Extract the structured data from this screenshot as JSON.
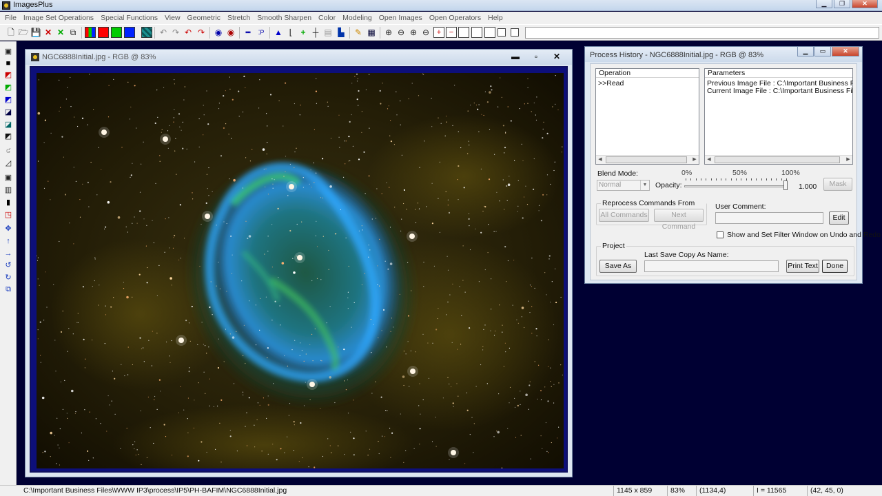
{
  "app": {
    "title": "ImagesPlus"
  },
  "menu": [
    "File",
    "Image Set Operations",
    "Special Functions",
    "View",
    "Geometric",
    "Stretch",
    "Smooth Sharpen",
    "Color",
    "Modeling",
    "Open Images",
    "Open Operators",
    "Help"
  ],
  "toolbar": {
    "icons": [
      "new-file-icon",
      "open-folder-icon",
      "save-icon",
      "close-x-icon",
      "close-all-icon",
      "copy-icon",
      "rgb-channels-icon",
      "red-channel-icon",
      "green-channel-icon",
      "blue-channel-icon",
      "mono-channel-icon",
      "undo-icon",
      "redo-icon",
      "undo-all-icon",
      "redo-all-icon",
      "circle-select-icon",
      "circle-select-alt-icon",
      "dotted-line-icon",
      "point-select-icon",
      "histogram-icon",
      "curve-icon",
      "crosshair-icon",
      "grid-crosshair-icon",
      "table-icon",
      "image-edit-icon",
      "pencil-icon",
      "grid-icon",
      "zoom-in-icon",
      "zoom-out-icon",
      "zoom-fit-icon",
      "zoom-actual-icon",
      "add-window-icon",
      "remove-window-icon",
      "window-frame-icon",
      "window-frame-2-icon",
      "window-frame-3-icon",
      "window-frame-4-icon",
      "window-frame-5-icon"
    ],
    "colors": {
      "red": "#ff0000",
      "green": "#00cc00",
      "blue": "#0022ff",
      "teal": "#1a8f8f"
    }
  },
  "image_window": {
    "title": "NGC6888Initial.jpg - RGB @ 83%"
  },
  "process_history": {
    "title": "Process History - NGC6888Initial.jpg - RGB @ 83%",
    "operation_header": "Operation",
    "parameters_header": "Parameters",
    "operations": [
      ">>Read"
    ],
    "parameters": [
      "Previous Image File : C:\\Important Business Files\\WW...",
      "Current Image File : C:\\Important Business Files\\WW..."
    ],
    "blend_mode_label": "Blend Mode:",
    "blend_mode_value": "Normal",
    "opacity_label": "Opacity:",
    "opacity_value": "1.000",
    "opacity": 1.0,
    "tick_0": "0%",
    "tick_50": "50%",
    "tick_100": "100%",
    "mask_button": "Mask",
    "reprocess_group": "Reprocess Commands From Current >>",
    "all_commands_button": "All Commands",
    "next_command_button": "Next Command",
    "user_comment_label": "User Comment:",
    "edit_button": "Edit",
    "show_filter_label": "Show and Set Filter Window on Undo and Redo",
    "project_group": "Project",
    "last_save_label": "Last Save Copy As Name:",
    "save_as_button": "Save As",
    "print_text_button": "Print Text",
    "done_button": "Done"
  },
  "status": {
    "path": "C:\\Important Business Files\\WWW IP3\\process\\IP5\\PH-BAFIM\\NGC6888Initial.jpg",
    "size": "1145 x 859",
    "zoom": "83%",
    "coords": "(1134,4)",
    "intensity": "I = 11565",
    "rgb": "(42, 45, 0)"
  }
}
